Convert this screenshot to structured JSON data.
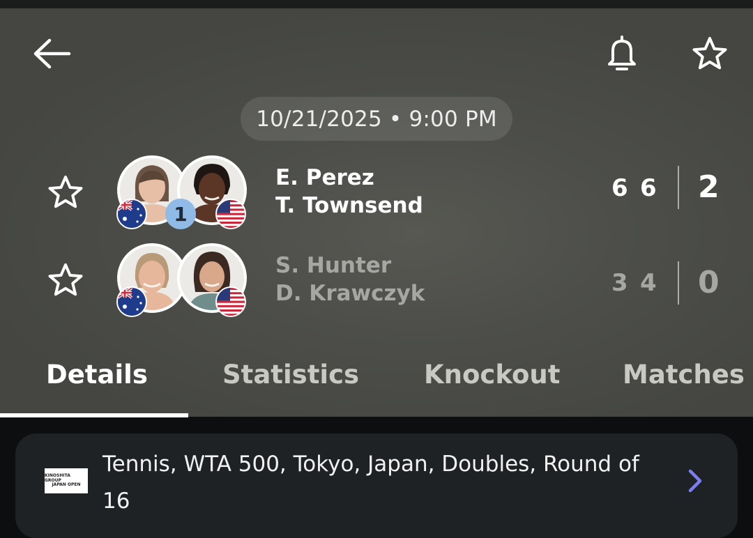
{
  "header": {
    "datetime": "10/21/2025 • 9:00 PM"
  },
  "icons": {
    "back": "arrow-left-icon",
    "notify": "bell-icon",
    "favorite": "star-outline-icon"
  },
  "teams": [
    {
      "players": [
        "E. Perez",
        "T. Townsend"
      ],
      "flags": [
        "AUS",
        "USA"
      ],
      "seed": "1",
      "sets": [
        "6",
        "6"
      ],
      "total": "2",
      "winner": true
    },
    {
      "players": [
        "S. Hunter",
        "D. Krawczyk"
      ],
      "flags": [
        "AUS",
        "USA"
      ],
      "seed": "",
      "sets": [
        "3",
        "4"
      ],
      "total": "0",
      "winner": false
    }
  ],
  "tabs": [
    {
      "label": "Details",
      "active": true
    },
    {
      "label": "Statistics",
      "active": false
    },
    {
      "label": "Knockout",
      "active": false
    },
    {
      "label": "Matches",
      "active": false
    }
  ],
  "tournament": {
    "logo_line1": "KINOSHITA GROUP",
    "logo_line2": "JAPAN OPEN",
    "text": "Tennis, WTA 500, Tokyo, Japan, Doubles, Round of 16"
  },
  "colors": {
    "seed_badge": "#8fbbe6",
    "chevron": "#7b7ff0",
    "header_bg": "#4d4e4a",
    "card_bg": "#1f2224"
  }
}
